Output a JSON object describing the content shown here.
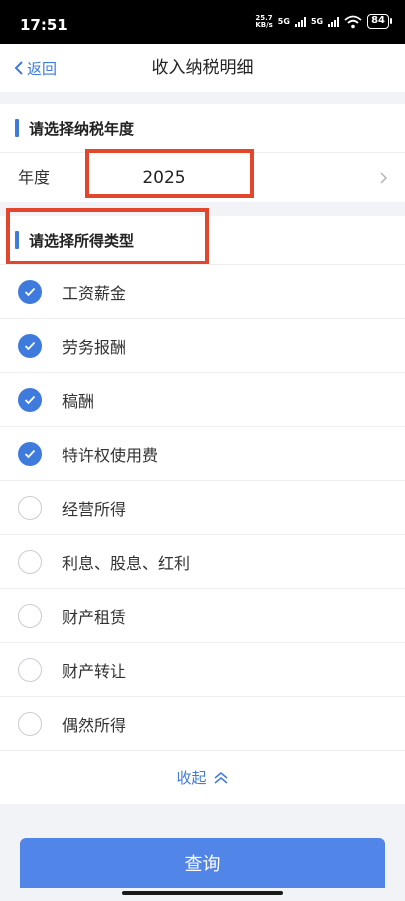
{
  "status_bar": {
    "time": "17:51",
    "net_speed_top": "25.7",
    "net_speed_bottom": "KB/s",
    "signal1": "5G",
    "signal2": "5G",
    "battery": "84"
  },
  "nav": {
    "back_label": "返回",
    "title": "收入纳税明细"
  },
  "year_section": {
    "heading": "请选择纳税年度",
    "row_label": "年度",
    "value": "2025"
  },
  "income_section": {
    "heading": "请选择所得类型",
    "items": [
      {
        "label": "工资薪金",
        "checked": true
      },
      {
        "label": "劳务报酬",
        "checked": true
      },
      {
        "label": "稿酬",
        "checked": true
      },
      {
        "label": "特许权使用费",
        "checked": true
      },
      {
        "label": "经营所得",
        "checked": false
      },
      {
        "label": "利息、股息、红利",
        "checked": false
      },
      {
        "label": "财产租赁",
        "checked": false
      },
      {
        "label": "财产转让",
        "checked": false
      },
      {
        "label": "偶然所得",
        "checked": false
      }
    ],
    "collapse_label": "收起"
  },
  "query_button": "查询",
  "colors": {
    "accent": "#3f7bdc",
    "button": "#5285e8",
    "highlight": "#e2472e"
  }
}
